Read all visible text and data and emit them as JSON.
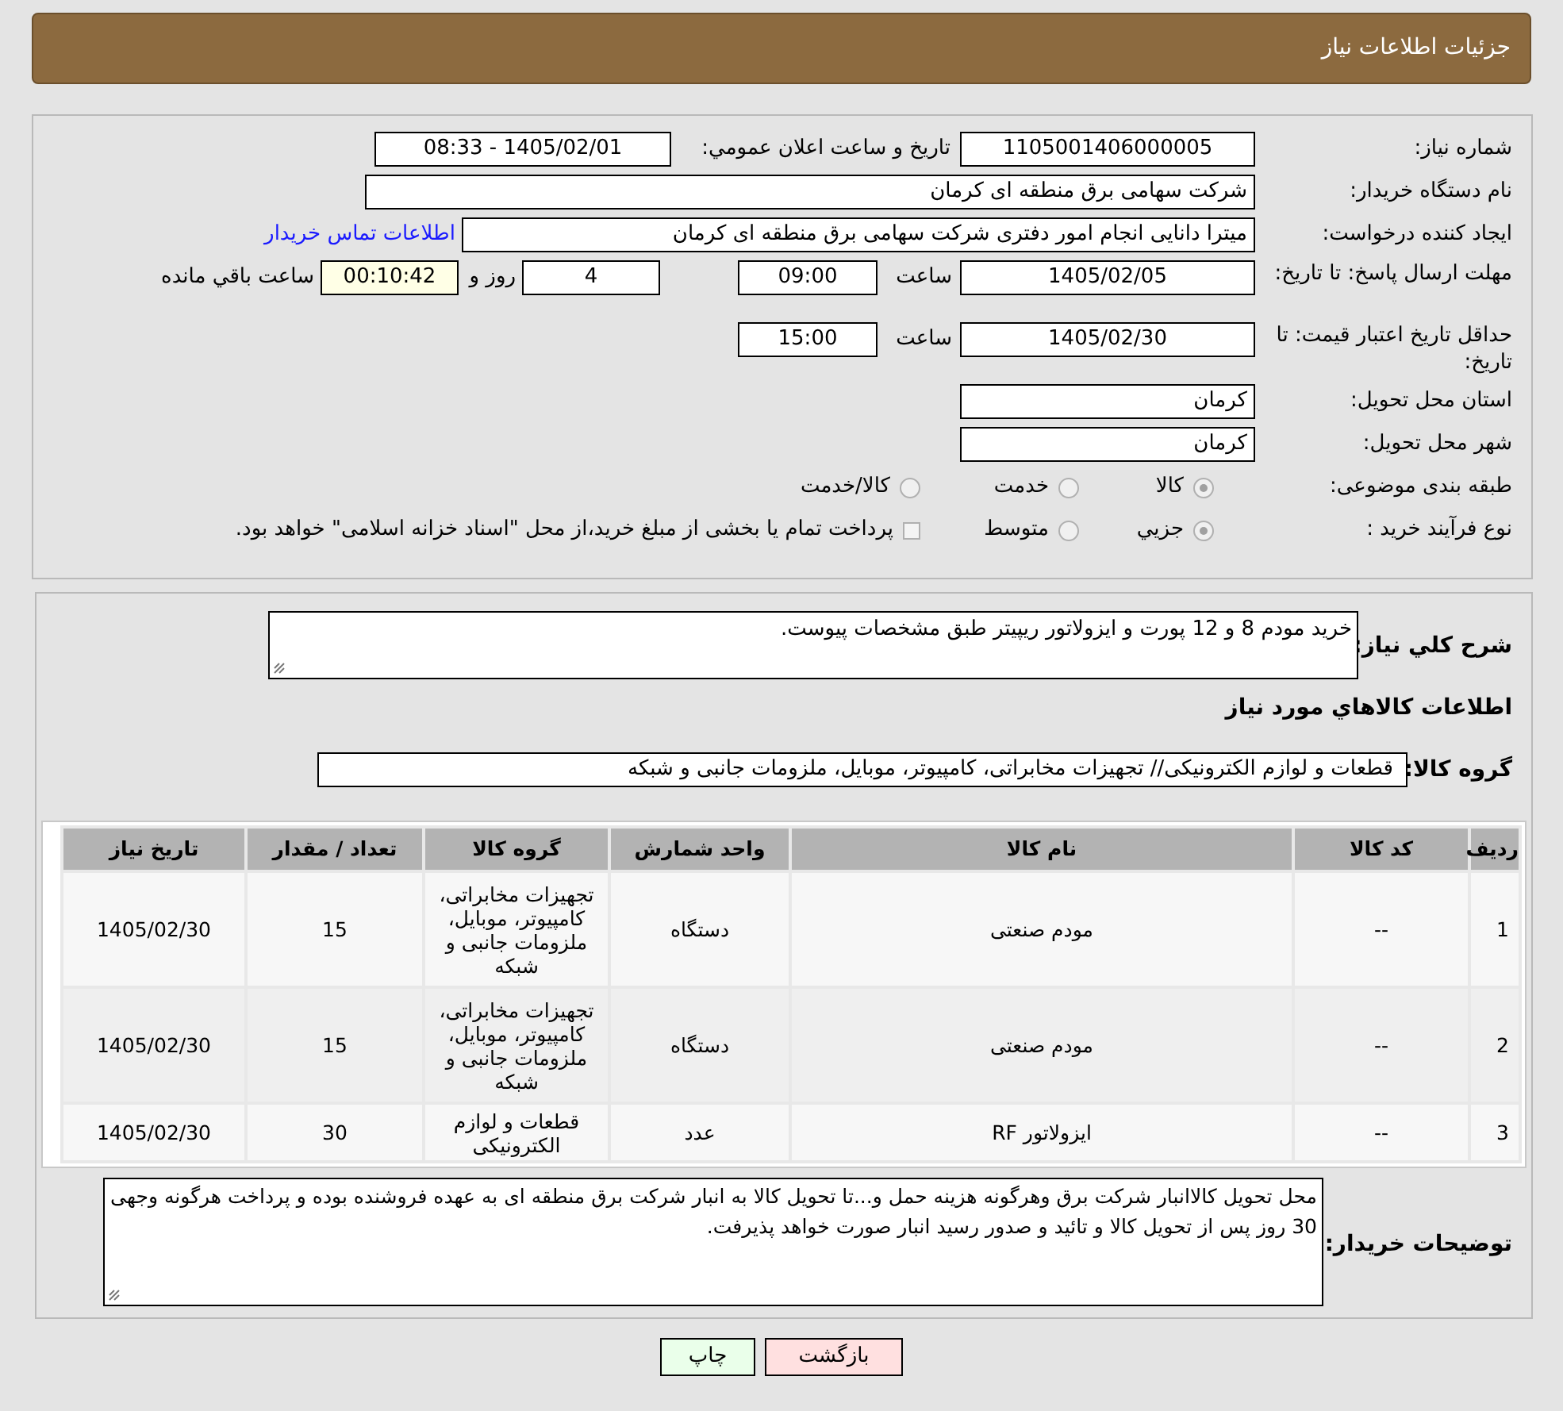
{
  "page_title": "جزئیات اطلاعات نیاز",
  "need_info": {
    "need_number": {
      "label": "شماره نیاز:",
      "value": "1105001406000005"
    },
    "announce_datetime": {
      "label": "تاریخ و ساعت اعلان عمومي:",
      "value": "1405/02/01 - 08:33"
    },
    "buyer_org": {
      "label": "نام دستگاه خریدار:",
      "value": "شرکت سهامی برق منطقه ای کرمان"
    },
    "requester": {
      "label": "ایجاد کننده درخواست:",
      "value": "میترا دانایی انجام امور دفتری شرکت سهامی برق منطقه ای کرمان",
      "contact_link": "اطلاعات تماس خریدار"
    },
    "reply_deadline": {
      "label": "مهلت ارسال پاسخ: تا تاریخ:",
      "date": "1405/02/05",
      "time_label": "ساعت",
      "time": "09:00",
      "days": "4",
      "days_label": "روز و",
      "remaining": "00:10:42",
      "remaining_label": "ساعت باقي مانده"
    },
    "price_validity": {
      "label": "حداقل تاریخ اعتبار قیمت: تا تاریخ:",
      "date": "1405/02/30",
      "time_label": "ساعت",
      "time": "15:00"
    },
    "province": {
      "label": "استان محل تحویل:",
      "value": "کرمان"
    },
    "city": {
      "label": "شهر محل تحویل:",
      "value": "کرمان"
    },
    "category": {
      "label": "طبقه بندی موضوعی:",
      "options": [
        {
          "label": "کالا",
          "selected": true
        },
        {
          "label": "خدمت",
          "selected": false
        },
        {
          "label": "کالا/خدمت",
          "selected": false
        }
      ]
    },
    "purchase_process": {
      "label": "نوع فرآیند خرید :",
      "options": [
        {
          "label": "جزيي",
          "selected": true
        },
        {
          "label": "متوسط",
          "selected": false
        }
      ],
      "payment_note": {
        "label": "پرداخت تمام یا بخشی از مبلغ خرید،از محل \"اسناد خزانه اسلامی\" خواهد بود.",
        "checked": false
      }
    }
  },
  "details": {
    "description": {
      "label": "شرح کلي نیاز:",
      "value": "خرید مودم 8 و 12 پورت و ایزولاتور ریپیتر طبق مشخصات پیوست."
    },
    "goods_heading": "اطلاعات کالاهاي مورد نیاز",
    "goods_group": {
      "label": "گروه کالا:",
      "value": "قطعات و لوازم الکترونیکی// تجهیزات مخابراتی، کامپیوتر، موبایل، ملزومات جانبی و شبکه"
    },
    "table": {
      "columns": [
        "ردیف",
        "کد کالا",
        "نام کالا",
        "واحد شمارش",
        "گروه کالا",
        "تعداد / مقدار",
        "تاریخ نیاز"
      ],
      "rows": [
        [
          "1",
          "--",
          "مودم صنعتی",
          "دستگاه",
          "تجهیزات مخابراتی، کامپیوتر، موبایل، ملزومات جانبی و شبکه",
          "15",
          "1405/02/30"
        ],
        [
          "2",
          "--",
          "مودم صنعتی",
          "دستگاه",
          "تجهیزات مخابراتی، کامپیوتر، موبایل، ملزومات جانبی و شبکه",
          "15",
          "1405/02/30"
        ],
        [
          "3",
          "--",
          "ایزولاتور RF",
          "عدد",
          "قطعات و لوازم الکترونیکی",
          "30",
          "1405/02/30"
        ]
      ]
    },
    "buyer_notes": {
      "label": "توضیحات خریدار:",
      "value": "محل تحویل کالاانبار شرکت برق وهرگونه هزینه حمل و...تا تحویل کالا به انبار شرکت برق منطقه ای به عهده فروشنده بوده و پرداخت هرگونه وجهی 30 روز پس از تحویل کالا و تائید و صدور رسید انبار صورت خواهد پذیرفت."
    }
  },
  "buttons": [
    {
      "label": "بازگشت",
      "kind": "back"
    },
    {
      "label": "چاپ",
      "kind": "print"
    }
  ]
}
